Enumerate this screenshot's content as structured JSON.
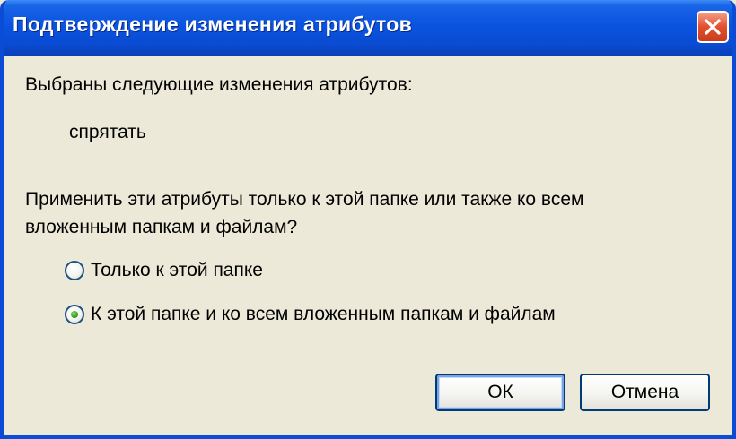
{
  "window": {
    "title": "Подтверждение изменения атрибутов",
    "close_icon": "close-icon"
  },
  "body": {
    "selected_text": "Выбраны следующие изменения атрибутов:",
    "change_item": "спрятать",
    "question_line1": "Применить эти атрибуты только к этой папке или также ко всем",
    "question_line2": "вложенным папкам и файлам?"
  },
  "options": [
    {
      "label": "Только к этой папке",
      "selected": false
    },
    {
      "label": "К этой папке и ко всем вложенным папкам и файлам",
      "selected": true
    }
  ],
  "buttons": {
    "ok_label": "ОК",
    "cancel_label": "Отмена"
  },
  "colors": {
    "titlebar": "#0a54e0",
    "close_button": "#e2502d",
    "dialog_background": "#ece9d8",
    "radio_dot": "#33a31c"
  }
}
